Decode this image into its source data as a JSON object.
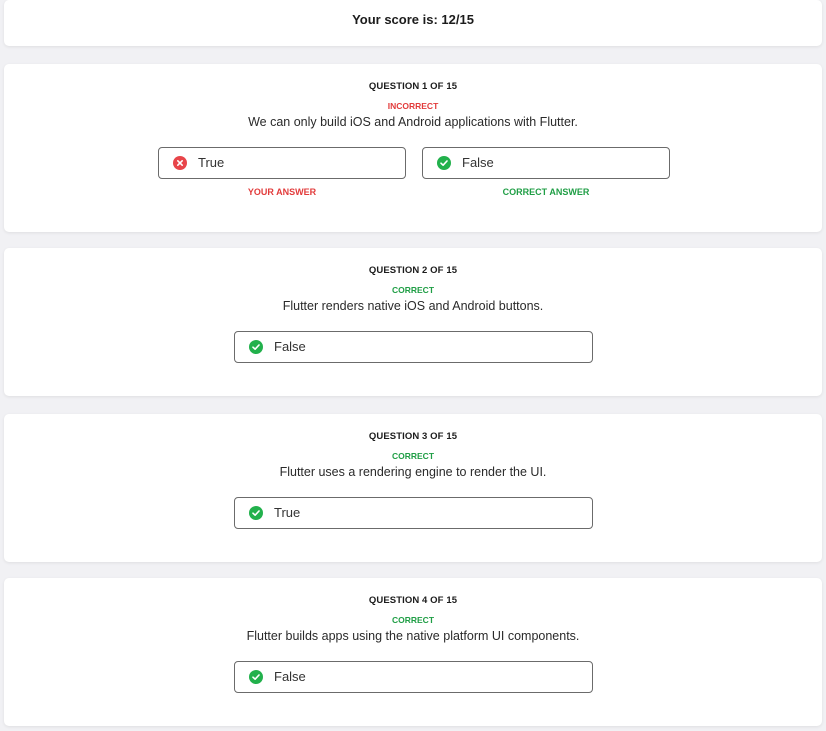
{
  "score": {
    "text": "Your score is: 12/15"
  },
  "questions": [
    {
      "number": "QUESTION 1 OF 15",
      "status": "INCORRECT",
      "text": "We can only build iOS and Android applications with Flutter.",
      "options": [
        {
          "label": "True",
          "icon": "x-circle-icon",
          "caption": "YOUR ANSWER"
        },
        {
          "label": "False",
          "icon": "check-circle-icon",
          "caption": "CORRECT ANSWER"
        }
      ]
    },
    {
      "number": "QUESTION 2 OF 15",
      "status": "CORRECT",
      "text": "Flutter renders native iOS and Android buttons.",
      "options": [
        {
          "label": "False",
          "icon": "check-circle-icon"
        }
      ]
    },
    {
      "number": "QUESTION 3 OF 15",
      "status": "CORRECT",
      "text": "Flutter uses a rendering engine to render the UI.",
      "options": [
        {
          "label": "True",
          "icon": "check-circle-icon"
        }
      ]
    },
    {
      "number": "QUESTION 4 OF 15",
      "status": "CORRECT",
      "text": "Flutter builds apps using the native platform UI components.",
      "options": [
        {
          "label": "False",
          "icon": "check-circle-icon"
        }
      ]
    }
  ],
  "colors": {
    "incorrect": "#e23b3b",
    "correct": "#1f9e45",
    "check_icon": "#22b14c",
    "x_icon": "#e8454a"
  }
}
